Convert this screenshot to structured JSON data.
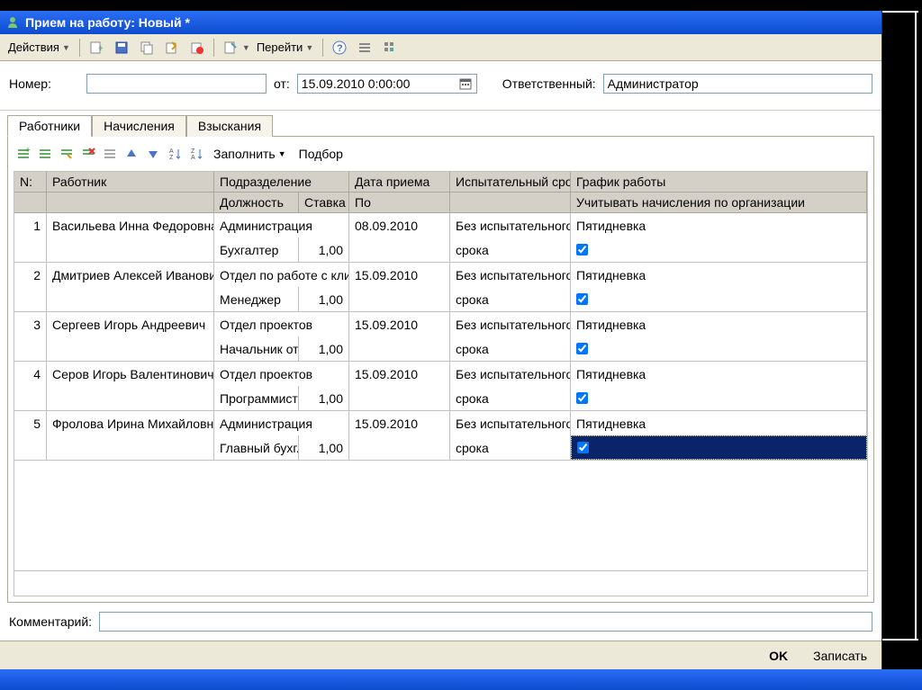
{
  "window": {
    "title": "Прием на работу: Новый *"
  },
  "toolbar": {
    "actions": "Действия",
    "goto": "Перейти"
  },
  "form": {
    "number_label": "Номер:",
    "number_value": "",
    "date_label": "от:",
    "date_value": "15.09.2010  0:00:00",
    "responsible_label": "Ответственный:",
    "responsible_value": "Администратор"
  },
  "tabs": {
    "workers": "Работники",
    "accruals": "Начисления",
    "penalties": "Взыскания"
  },
  "inner_tb": {
    "fill": "Заполнить",
    "pick": "Подбор"
  },
  "grid": {
    "headers": {
      "n": "N:",
      "worker": "Работник",
      "dept": "Подразделение",
      "position": "Должность",
      "rate": "Ставка",
      "hire_date": "Дата приема",
      "hire_to": "По",
      "trial": "Испытательный срок",
      "schedule": "График работы",
      "accrue_org": "Учитывать начисления по организации"
    },
    "rows": [
      {
        "n": "1",
        "worker": "Васильева Инна Федоровна",
        "dept": "Администрация",
        "position": "Бухгалтер",
        "rate": "1,00",
        "date": "08.09.2010",
        "trial": "Без испытательного срока",
        "schedule": "Пятидневка",
        "check": true
      },
      {
        "n": "2",
        "worker": "Дмитриев Алексей Иванович",
        "dept": "Отдел по работе с кли...",
        "position": "Менеджер",
        "rate": "1,00",
        "date": "15.09.2010",
        "trial": "Без испытательного срока",
        "schedule": "Пятидневка",
        "check": true
      },
      {
        "n": "3",
        "worker": "Сергеев Игорь Андреевич",
        "dept": "Отдел проектов",
        "position": "Начальник от...",
        "rate": "1,00",
        "date": "15.09.2010",
        "trial": "Без испытательного срока",
        "schedule": "Пятидневка",
        "check": true
      },
      {
        "n": "4",
        "worker": "Серов Игорь Валентинович",
        "dept": "Отдел проектов",
        "position": "Программист",
        "rate": "1,00",
        "date": "15.09.2010",
        "trial": "Без испытательного срока",
        "schedule": "Пятидневка",
        "check": true
      },
      {
        "n": "5",
        "worker": "Фролова Ирина Михайловна",
        "dept": "Администрация",
        "position": "Главный бухг...",
        "rate": "1,00",
        "date": "15.09.2010",
        "trial": "Без испытательного срока",
        "schedule": "Пятидневка",
        "check": true
      }
    ]
  },
  "comment": {
    "label": "Комментарий:",
    "value": ""
  },
  "footer": {
    "ok": "OK",
    "save": "Записать"
  }
}
